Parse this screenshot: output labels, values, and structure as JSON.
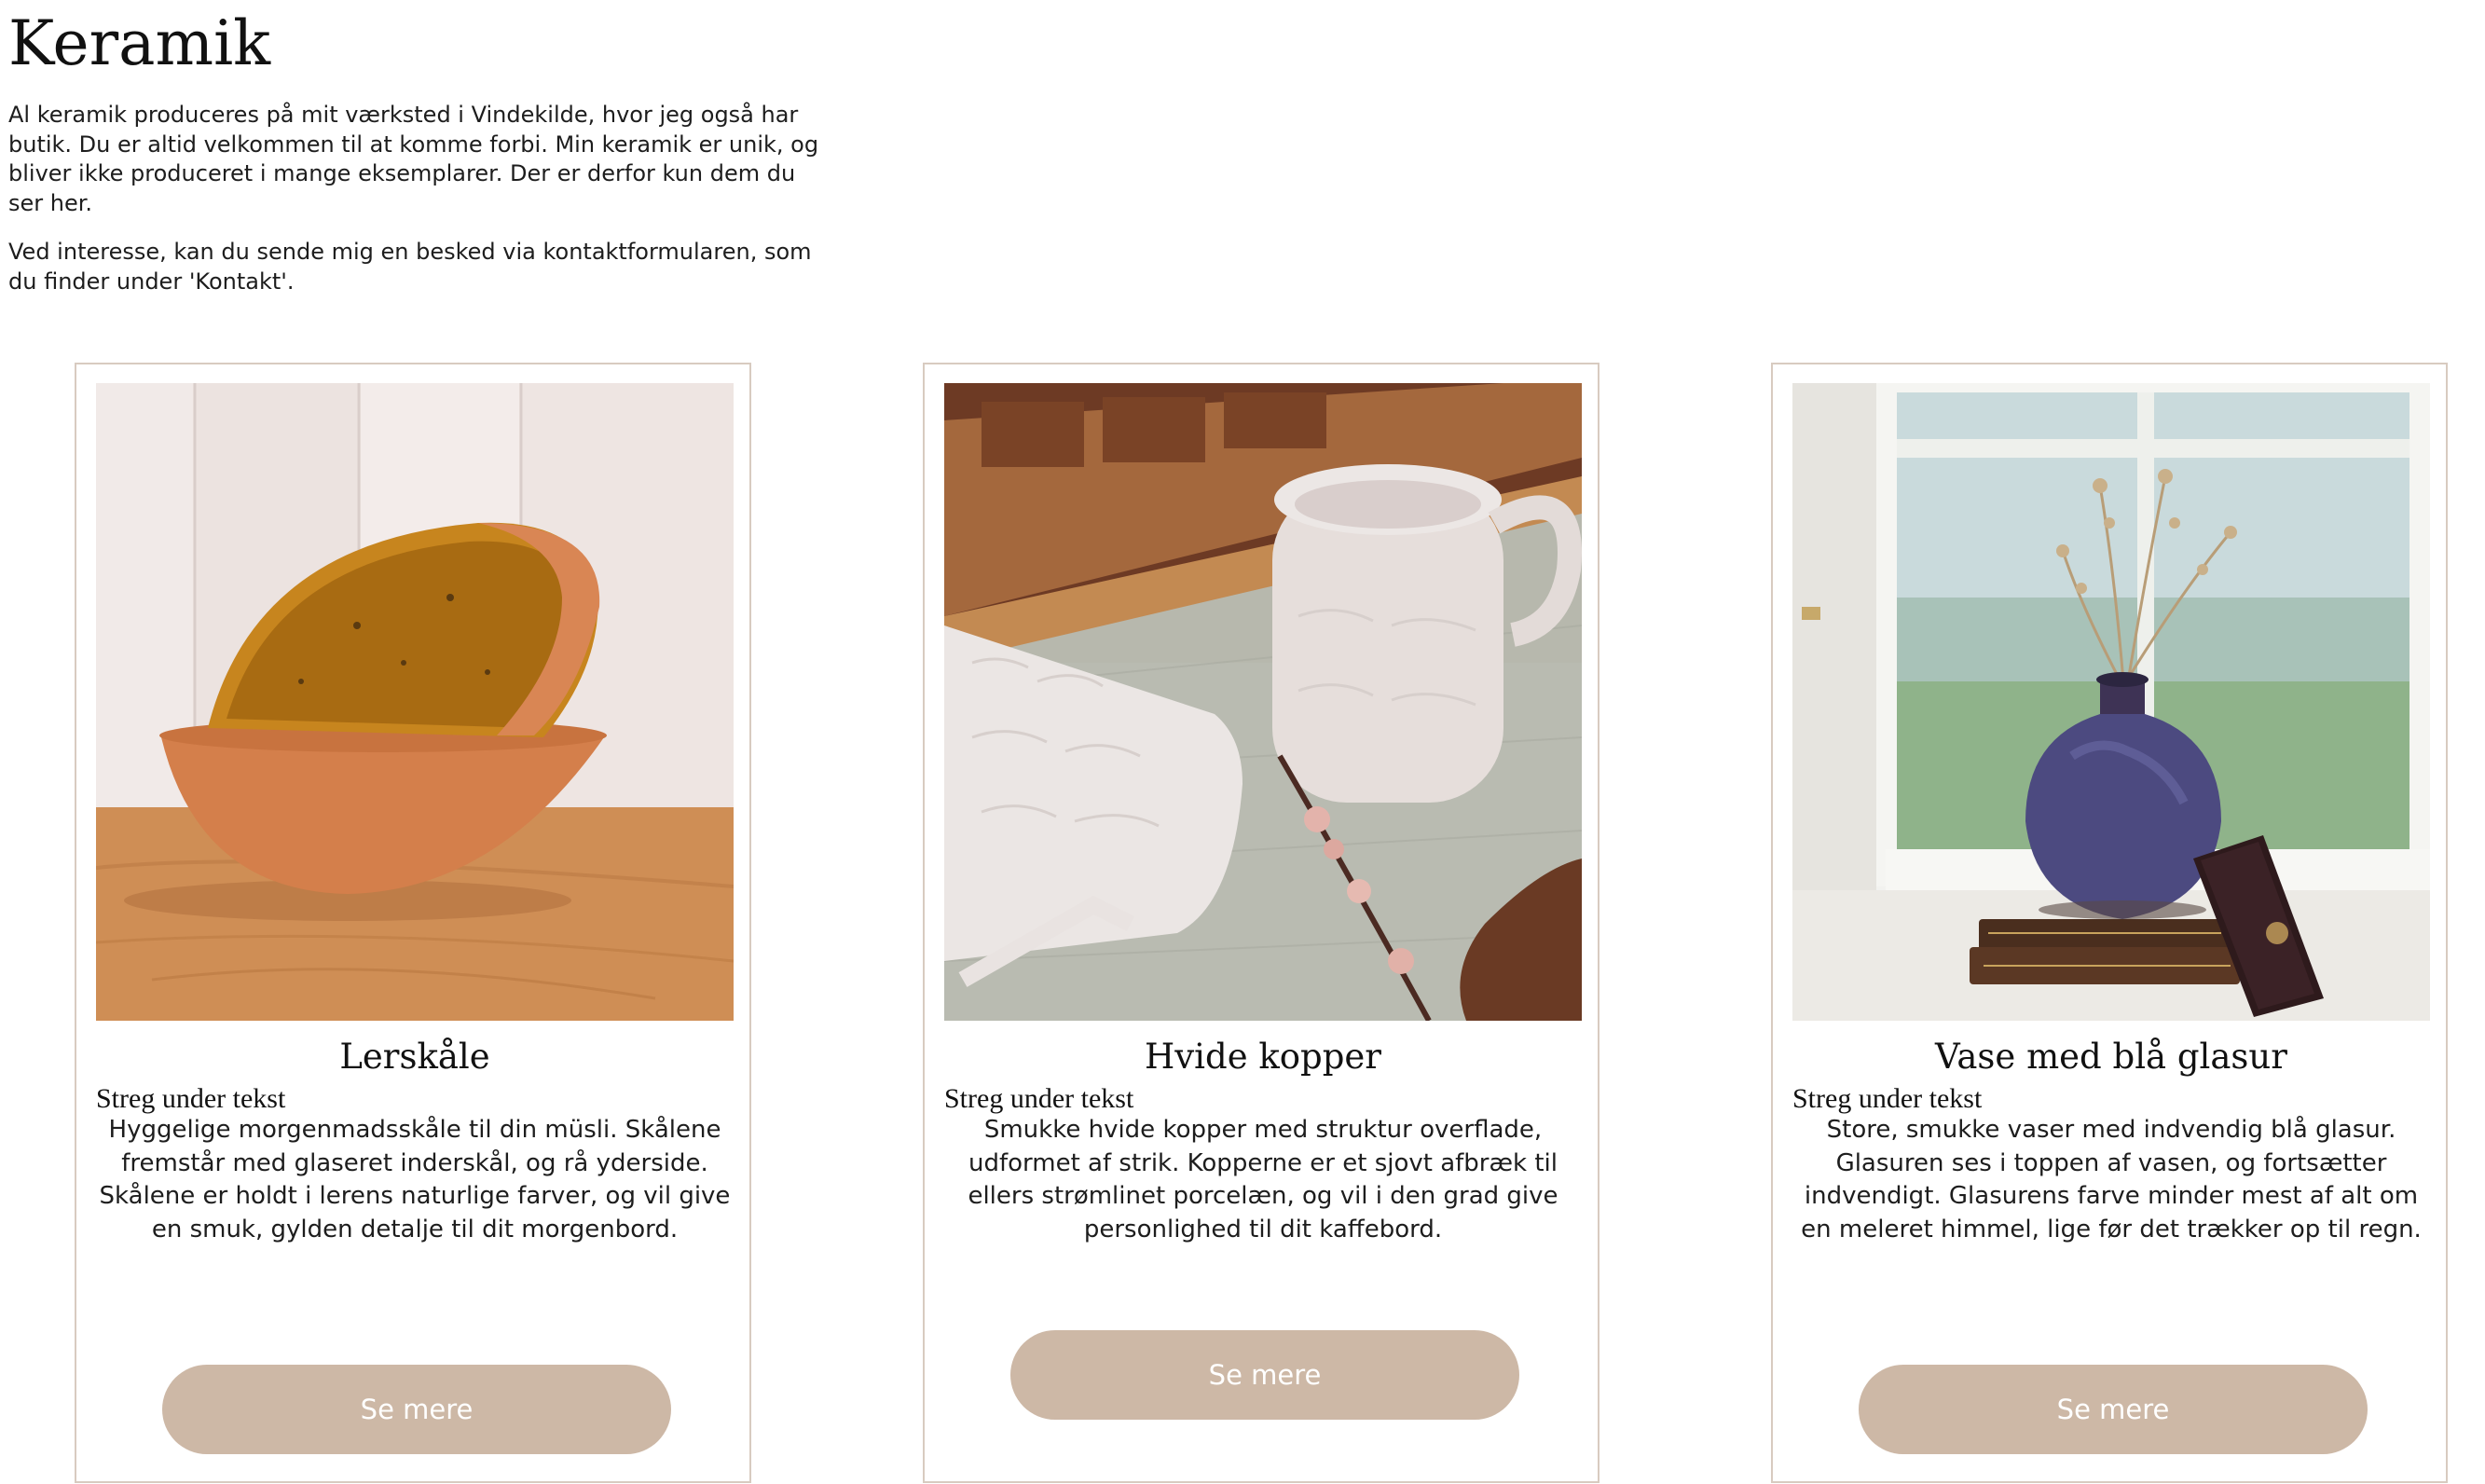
{
  "page": {
    "title": "Keramik",
    "intro": [
      "Al keramik produceres på mit værksted i Vindekilde, hvor jeg også har butik. Du er altid velkommen til at komme forbi. Min keramik er unik, og bliver ikke produceret i mange eksemplarer. Der er derfor kun dem du ser her.",
      "Ved interesse, kan du sende mig en besked via kontaktformularen, som du finder under 'Kontakt'."
    ]
  },
  "colors": {
    "accent_button": "#cdb8a6",
    "card_border": "#d8cbc0",
    "button_text": "#ffffff"
  },
  "products": [
    {
      "title": "Lerskåle",
      "subtitle": "Streg under tekst",
      "description": "Hyggelige morgenmadsskåle til din müsli. Skålene fremstår med glaseret inderskål, og rå yderside. Skålene er holdt i lerens naturlige farver, og vil give en smuk, gylden detalje til dit morgenbord.",
      "button_label": "Se mere",
      "image": "photo-orange-clay-bowls"
    },
    {
      "title": "Hvide kopper",
      "subtitle": "Streg under tekst",
      "description": "Smukke hvide kopper med struktur overflade, udformet af strik. Kopperne er et sjovt afbræk til ellers strømlinet porcelæn, og vil i den grad give personlighed til dit kaffebord.",
      "button_label": "Se mere",
      "image": "photo-white-textured-cups"
    },
    {
      "title": "Vase med blå glasur",
      "subtitle": "Streg under tekst",
      "description": "Store, smukke vaser med indvendig blå glasur. Glasuren ses i toppen af vasen, og fortsætter indvendigt. Glasurens farve minder mest af alt om en meleret himmel, lige før det trækker op til regn.",
      "button_label": "Se mere",
      "image": "photo-blue-glazed-vase"
    }
  ]
}
